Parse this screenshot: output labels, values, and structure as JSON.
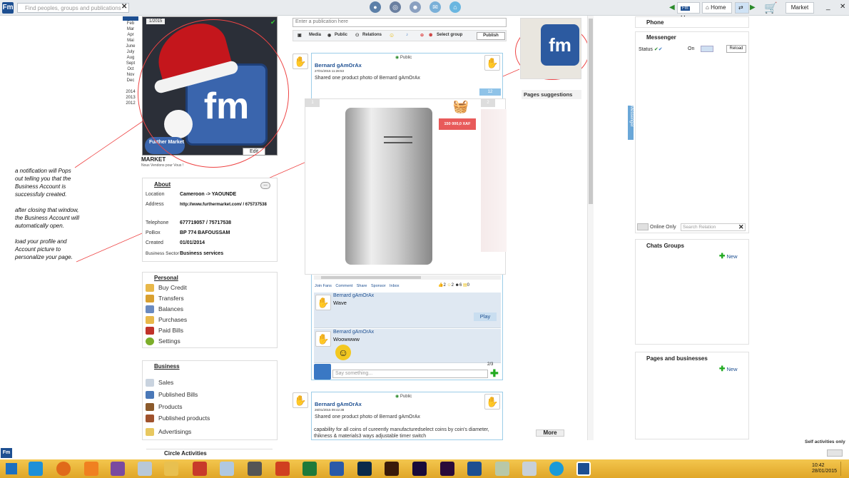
{
  "topbar": {
    "search_placeholder": "Find peoples, groups and publications",
    "me_label": "Me",
    "home_label": "Home",
    "market_label": "Market"
  },
  "calendar": {
    "months": [
      "Feb",
      "Mar",
      "Apr",
      "Mai",
      "June",
      "July",
      "Aug",
      "Sept",
      "Oct",
      "Nov",
      "Dec"
    ],
    "years": [
      "2014",
      "2013",
      "2012"
    ]
  },
  "profile": {
    "cover_date": "1/2015",
    "name": "MARKET",
    "slogan": "Nous Vendons pour Vous !",
    "edit_label": "Edit",
    "badge_text": "Further Market"
  },
  "note": {
    "lines": [
      "a notification will Pops out telling you that the Business Account is successfuly created.",
      "after closing that window, the Business Account will automatically open.",
      "load your  profile and Account picture to personalize your page."
    ]
  },
  "about": {
    "title": "About",
    "more": "...",
    "rows": [
      {
        "k": "Location",
        "v": "Cameroon -> YAOUNDE"
      },
      {
        "k": "Address",
        "v": "http://www.furthermarket.com/ / 675737538"
      },
      {
        "k": "Telephone",
        "v": "677719057 / 75717538"
      },
      {
        "k": "PoBox",
        "v": "BP 774 BAFOUSSAM"
      },
      {
        "k": "Created",
        "v": "01/01/2014"
      },
      {
        "k": "Business Sector",
        "v": "Business services"
      }
    ]
  },
  "personal": {
    "title": "Personal",
    "items": [
      "Buy Credit",
      "Transfers",
      "Balances",
      "Purchases",
      "Paid Bills",
      "Settings"
    ]
  },
  "business": {
    "title": "Business",
    "items": [
      "Sales",
      "Published Bills",
      "Products",
      "Published products",
      "Advertisings"
    ]
  },
  "circle_label": "Circle Activities",
  "composer": {
    "placeholder": "Enter a publication here",
    "media": "Media",
    "public": "Public",
    "relations": "Relations",
    "select_group": "Select group",
    "publish": "Publish"
  },
  "post1": {
    "visibility": "Public",
    "author": "Bernard gAmOrAx",
    "date": "27/01/2015 11:28:53",
    "text": "Shared one product photo of  Bernard gAmOrAx",
    "count": "12",
    "page_a": "1",
    "page_b": "2",
    "price": "150 000,0 XAF",
    "actions": [
      "Join Fans",
      "Comment",
      "Share",
      "Sponsor",
      "Inbox"
    ],
    "reactions": [
      "2",
      "2",
      "6",
      "0"
    ],
    "comment_count": "2/3",
    "comments": [
      {
        "author": "Bernard gAmOrAx",
        "text": "Wave"
      },
      {
        "author": "Bernard gAmOrAx",
        "text": "Woowwww"
      }
    ],
    "play_label": "Play",
    "say_placeholder": "Say something..."
  },
  "post2": {
    "visibility": "Public",
    "author": "Bernard gAmOrAx",
    "date": "26/01/2015 09:42:38",
    "text": "Shared one product photo of  Bernard gAmOrAx",
    "long_text": "capability for all coins of cureently manufacturedselect coins by coin's diameter, thikness & materials3 ways adjustable timer switch"
  },
  "more_label": "More",
  "pages": {
    "suggestions_label": "Pages suggestions"
  },
  "right": {
    "phone": "Phone",
    "messenger": "Messenger",
    "status": "Status",
    "on": "On",
    "reload": "Reload",
    "online_only": "Online Only",
    "search_relation": "Search Relation",
    "chats_groups": "Chats Groups",
    "new1": "New",
    "pages_businesses": "Pages and businesses",
    "new2": "New",
    "vertical_tab": "Messenger",
    "self_activities": "Self activities only"
  },
  "taskbar": {
    "time": "10:42",
    "date": "28/01/2015"
  },
  "colors": {
    "brand": "#1d4f91",
    "accent": "#3a65ad",
    "annotation": "#e44444",
    "taskbar": "#f3c64e"
  }
}
